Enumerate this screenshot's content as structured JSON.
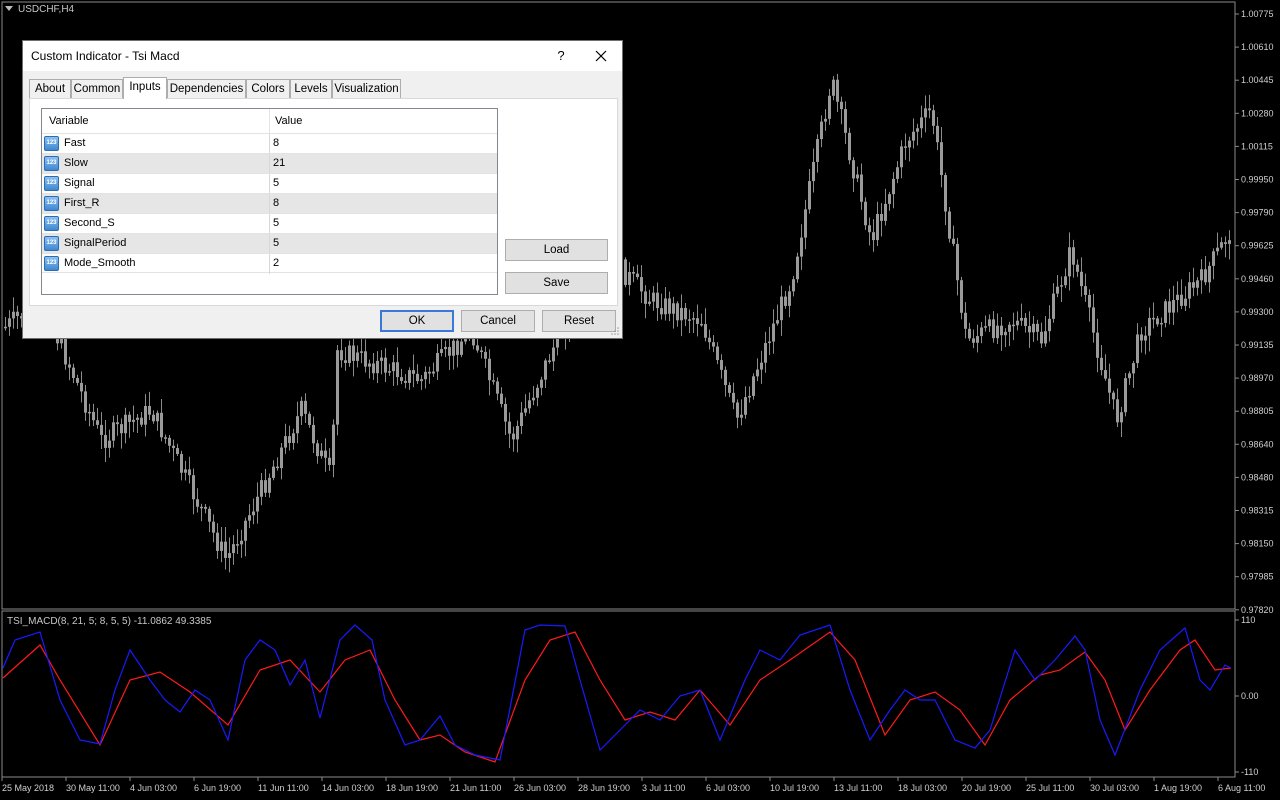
{
  "window": {
    "symbol_label": "USDCHF,H4"
  },
  "price_axis": {
    "labels": [
      "1.00775",
      "1.00610",
      "1.00445",
      "1.00280",
      "1.00115",
      "0.99950",
      "0.99790",
      "0.99625",
      "0.99460",
      "0.99300",
      "0.99135",
      "0.98970",
      "0.98805",
      "0.98640",
      "0.98480",
      "0.98315",
      "0.98150",
      "0.97985",
      "0.97820"
    ]
  },
  "indicator": {
    "title": "TSI_MACD(8, 21, 5; 8, 5, 5) -11.0862 49.3385",
    "axis_labels": [
      "110",
      "0.00",
      "-110"
    ],
    "colors": {
      "main": "#1a1aff",
      "signal": "#ff1a1a"
    }
  },
  "time_axis": {
    "labels": [
      "25 May 2018",
      "30 May 11:00",
      "4 Jun 03:00",
      "6 Jun 19:00",
      "11 Jun 11:00",
      "14 Jun 03:00",
      "18 Jun 19:00",
      "21 Jun 11:00",
      "26 Jun 03:00",
      "28 Jun 19:00",
      "3 Jul 11:00",
      "6 Jul 03:00",
      "10 Jul 19:00",
      "13 Jul 11:00",
      "18 Jul 03:00",
      "20 Jul 19:00",
      "25 Jul 11:00",
      "30 Jul 03:00",
      "1 Aug 19:00",
      "6 Aug 11:00"
    ]
  },
  "dialog": {
    "title": "Custom Indicator - Tsi Macd",
    "help_label": "?",
    "tabs": [
      "About",
      "Common",
      "Inputs",
      "Dependencies",
      "Colors",
      "Levels",
      "Visualization"
    ],
    "active_tab": "Inputs",
    "grid": {
      "headers": {
        "variable": "Variable",
        "value": "Value"
      },
      "icon_text": "123",
      "rows": [
        {
          "name": "Fast",
          "value": "8"
        },
        {
          "name": "Slow",
          "value": "21"
        },
        {
          "name": "Signal",
          "value": "5"
        },
        {
          "name": "First_R",
          "value": "8"
        },
        {
          "name": "Second_S",
          "value": "5"
        },
        {
          "name": "SignalPeriod",
          "value": "5"
        },
        {
          "name": "Mode_Smooth",
          "value": "2"
        }
      ]
    },
    "buttons": {
      "load": "Load",
      "save": "Save",
      "ok": "OK",
      "cancel": "Cancel",
      "reset": "Reset"
    }
  }
}
